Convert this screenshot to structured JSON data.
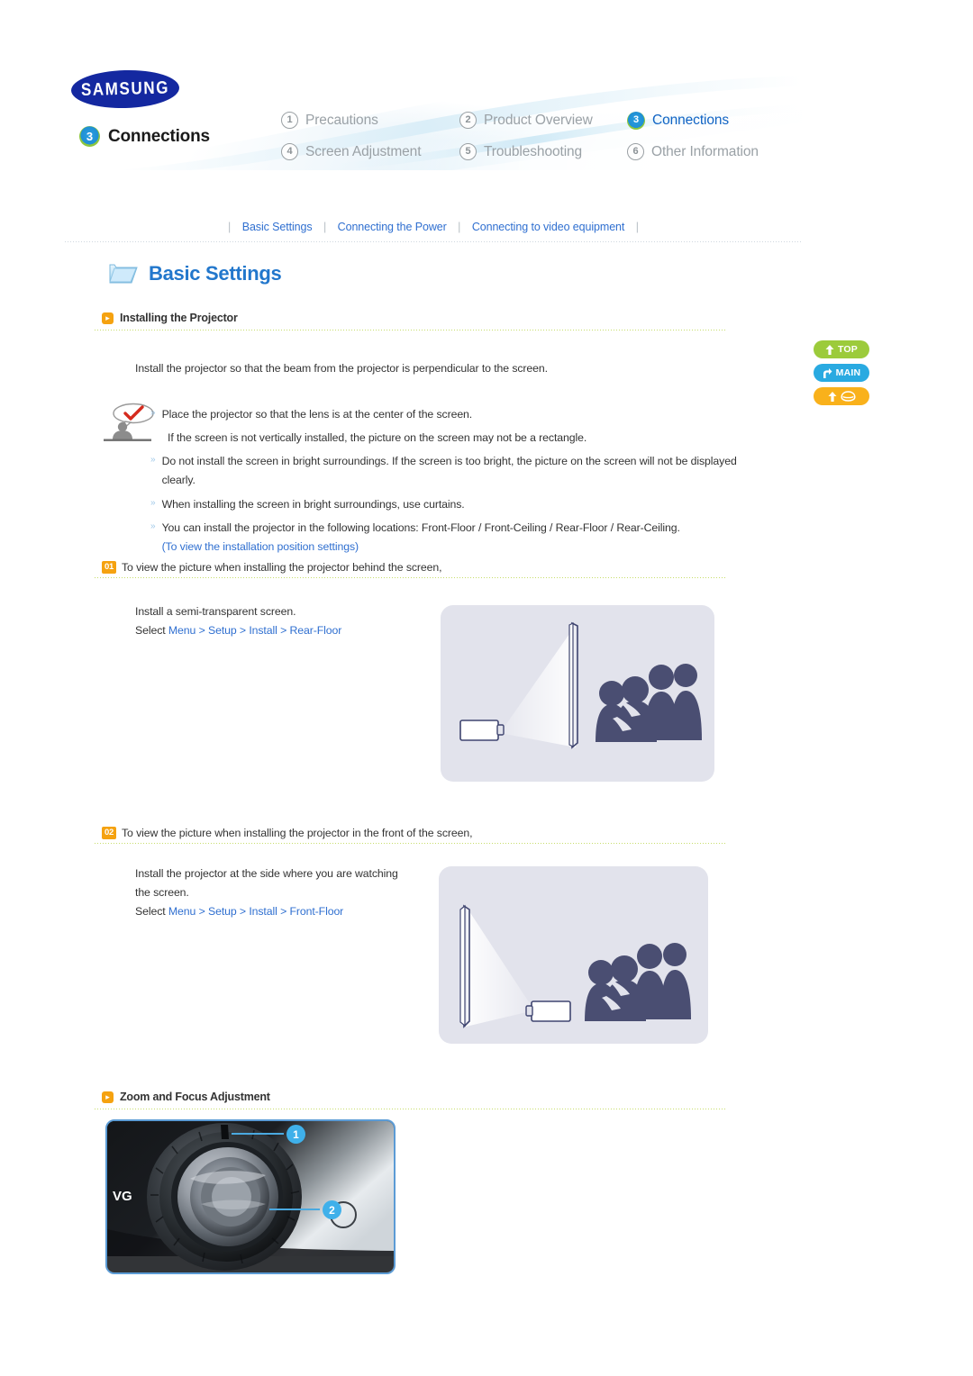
{
  "brand": {
    "logo_text": "SAMSUNG"
  },
  "header": {
    "current_chapter": {
      "number": "3",
      "label": "Connections"
    },
    "menu": [
      {
        "number": "1",
        "label": "Precautions",
        "active": false
      },
      {
        "number": "2",
        "label": "Product Overview",
        "active": false
      },
      {
        "number": "3",
        "label": "Connections",
        "active": true
      },
      {
        "number": "4",
        "label": "Screen Adjustment",
        "active": false
      },
      {
        "number": "5",
        "label": "Troubleshooting",
        "active": false
      },
      {
        "number": "6",
        "label": "Other Information",
        "active": false
      }
    ]
  },
  "topnav": {
    "links": [
      "Basic Settings",
      "Connecting the Power",
      "Connecting to video equipment"
    ],
    "separator": "|"
  },
  "page": {
    "title": "Basic Settings"
  },
  "sections": {
    "installing": {
      "heading": "Installing the Projector",
      "intro": "Install the projector so that the beam from the projector is perpendicular to the screen.",
      "notes": [
        {
          "bullet": true,
          "text": "Place the projector so that the lens is at the center of the screen."
        },
        {
          "bullet": false,
          "text": "If the screen is not vertically installed, the picture on the screen may not be a rectangle."
        },
        {
          "bullet": true,
          "text": "Do not install the screen in bright surroundings. If the screen is too bright, the picture on the screen will not be displayed clearly."
        },
        {
          "bullet": true,
          "text": "When installing the screen in bright surroundings, use curtains."
        },
        {
          "bullet": true,
          "text": "You can install the projector in the following locations: Front-Floor / Front-Ceiling / Rear-Floor / Rear-Ceiling."
        }
      ],
      "note_link": "(To view the installation position settings)"
    },
    "step01": {
      "number": "01",
      "label": "To view the picture when installing the projector behind the screen,",
      "line1": "Install a semi-transparent screen.",
      "select_prefix": "Select ",
      "select_path": "Menu > Setup > Install > Rear-Floor"
    },
    "step02": {
      "number": "02",
      "label": "To view the picture when installing the projector in the front of the screen,",
      "line1": "Install the projector at the side where you are watching",
      "line2": "the screen.",
      "select_prefix": "Select ",
      "select_path": "Menu > Setup > Install > Front-Floor"
    },
    "zoomfocus": {
      "heading": "Zoom and Focus Adjustment",
      "callouts": [
        "1",
        "2"
      ],
      "device_text": "VG"
    }
  },
  "side_buttons": [
    {
      "name": "top",
      "label": "TOP",
      "icon": "up-arrow-icon",
      "color": "#9ccb3b"
    },
    {
      "name": "main",
      "label": "MAIN",
      "icon": "branch-arrow-icon",
      "color": "#29aae1"
    },
    {
      "name": "home",
      "label": "",
      "icon": "home-icon",
      "color": "#f9b11b"
    }
  ],
  "colors": {
    "accent_blue": "#2277cc",
    "link_blue": "#2f6fd0",
    "orange": "#f5a210",
    "green": "#9ccb3b",
    "cyan": "#29aae1",
    "illus_bg": "#e2e3ec",
    "silhouette": "#4a4e72"
  }
}
